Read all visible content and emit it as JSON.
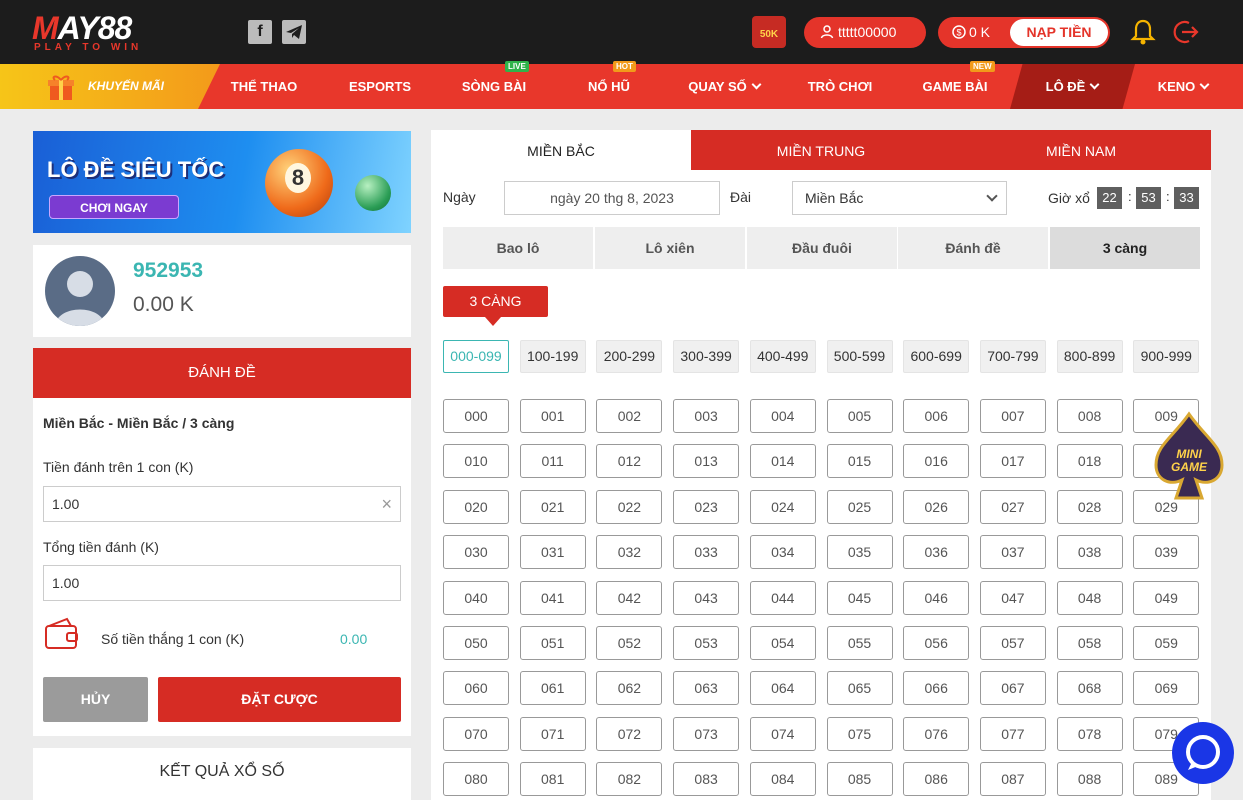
{
  "header": {
    "logo_text": "MAY88",
    "logo_tagline": "PLAY TO WIN",
    "social_facebook": "f",
    "gift_badge": "50K",
    "username": "ttttt00000",
    "balance": "0 K",
    "deposit_label": "NẠP TIỀN"
  },
  "nav": {
    "promo": "KHUYẾN MÃI",
    "items": [
      {
        "label": "THỂ THAO",
        "badge": ""
      },
      {
        "label": "ESPORTS",
        "badge": ""
      },
      {
        "label": "SÒNG BÀI",
        "badge": "LIVE"
      },
      {
        "label": "NỔ HŨ",
        "badge": "HOT"
      },
      {
        "label": "QUAY SỐ",
        "badge": ""
      },
      {
        "label": "TRÒ CHƠI",
        "badge": ""
      },
      {
        "label": "GAME BÀI",
        "badge": "NEW"
      },
      {
        "label": "LÔ ĐỀ",
        "badge": ""
      },
      {
        "label": "KENO",
        "badge": ""
      }
    ],
    "badge_colors": {
      "LIVE": "#2fb34a",
      "HOT": "#f29a1a",
      "NEW": "#f29a1a"
    }
  },
  "banner": {
    "title": "LÔ ĐỀ SIÊU TỐC",
    "button": "CHƠI NGAY",
    "ball_number": "8"
  },
  "user": {
    "id": "952953",
    "balance": "0.00 K"
  },
  "bet_form": {
    "header": "ĐÁNH ĐỀ",
    "path": "Miền Bắc - Miền Bắc / 3 càng",
    "stake_label": "Tiền đánh trên 1 con (K)",
    "stake_value": "1.00",
    "total_label": "Tổng tiền đánh (K)",
    "total_value": "1.00",
    "win_label": "Số tiền thắng 1 con (K)",
    "win_value": "0.00",
    "cancel": "HỦY",
    "place": "ĐẶT CƯỢC"
  },
  "results_title": "KẾT QUẢ XỔ SỐ",
  "regions": [
    "MIỀN BẮC",
    "MIỀN TRUNG",
    "MIỀN NAM"
  ],
  "filters": {
    "date_label": "Ngày",
    "date_value": "ngày 20 thg 8, 2023",
    "station_label": "Đài",
    "station_value": "Miền Bắc",
    "draw_time_label": "Giờ xổ",
    "hh": "22",
    "mm": "53",
    "ss": "33"
  },
  "bet_types": [
    "Bao lô",
    "Lô xiên",
    "Đầu đuôi",
    "Đánh đề",
    "3 càng"
  ],
  "sub_type": "3 CÀNG",
  "ranges": [
    "000-099",
    "100-199",
    "200-299",
    "300-399",
    "400-499",
    "500-599",
    "600-699",
    "700-799",
    "800-899",
    "900-999"
  ],
  "numbers": [
    [
      "000",
      "001",
      "002",
      "003",
      "004",
      "005",
      "006",
      "007",
      "008",
      "009"
    ],
    [
      "010",
      "011",
      "012",
      "013",
      "014",
      "015",
      "016",
      "017",
      "018",
      "019"
    ],
    [
      "020",
      "021",
      "022",
      "023",
      "024",
      "025",
      "026",
      "027",
      "028",
      "029"
    ],
    [
      "030",
      "031",
      "032",
      "033",
      "034",
      "035",
      "036",
      "037",
      "038",
      "039"
    ],
    [
      "040",
      "041",
      "042",
      "043",
      "044",
      "045",
      "046",
      "047",
      "048",
      "049"
    ],
    [
      "050",
      "051",
      "052",
      "053",
      "054",
      "055",
      "056",
      "057",
      "058",
      "059"
    ],
    [
      "060",
      "061",
      "062",
      "063",
      "064",
      "065",
      "066",
      "067",
      "068",
      "069"
    ],
    [
      "070",
      "071",
      "072",
      "073",
      "074",
      "075",
      "076",
      "077",
      "078",
      "079"
    ],
    [
      "080",
      "081",
      "082",
      "083",
      "084",
      "085",
      "086",
      "087",
      "088",
      "089"
    ]
  ],
  "minigame_label": "MINI GAME",
  "colors": {
    "primary_red": "#d62c24",
    "accent_teal": "#3bb6b2",
    "header_dark": "#1c1c1c"
  }
}
